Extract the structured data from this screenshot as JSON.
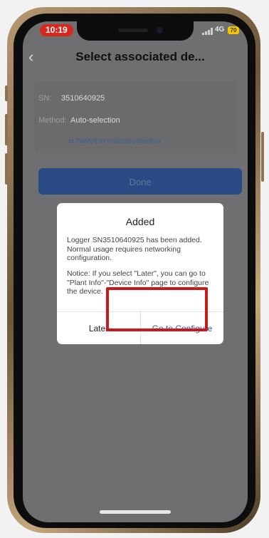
{
  "status_bar": {
    "time": "10:19",
    "network": "4G",
    "battery": "70"
  },
  "header": {
    "back_icon": "chevron-left-icon",
    "title": "Select associated de..."
  },
  "info": {
    "sn_label": "SN:",
    "sn_value": "3510640925",
    "method_label": "Method:",
    "method_value": "Auto-selection",
    "switch_link": "Switch to manual-selection",
    "switch_icon": "swap-icon"
  },
  "done_label": "Done",
  "dialog": {
    "title": "Added",
    "message": "Logger SN3510640925 has been added. Normal usage requires networking configuration.",
    "notice": "Notice: If you select \"Later\", you can go to \"Plant Info\"-\"Device Info\" page to configure the device.",
    "later_label": "Later",
    "configure_label": "Go to Configure"
  },
  "colors": {
    "highlight": "#c91a1a",
    "primary": "#2a4b86",
    "link": "#2f57a8"
  }
}
